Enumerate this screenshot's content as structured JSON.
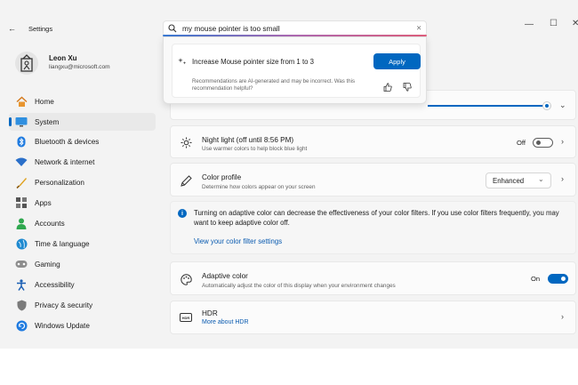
{
  "window": {
    "back_glyph": "←",
    "title": "Settings",
    "minimize_glyph": "—",
    "maximize_glyph": "☐",
    "close_glyph": "✕"
  },
  "user": {
    "name": "Leon Xu",
    "email": "liangxu@microsoft.com"
  },
  "search": {
    "query": "my mouse pointer is too small",
    "clear_glyph": "✕"
  },
  "recommendation": {
    "text": "Increase Mouse pointer size from 1 to 3",
    "apply_label": "Apply",
    "disclaimer": "Recommendations are AI-generated and may be incorrect. Was this recommendation helpful?"
  },
  "sidebar": {
    "items": [
      {
        "label": "Home",
        "icon": "home-icon"
      },
      {
        "label": "System",
        "icon": "system-icon",
        "selected": true
      },
      {
        "label": "Bluetooth & devices",
        "icon": "bluetooth-icon"
      },
      {
        "label": "Network & internet",
        "icon": "wifi-icon"
      },
      {
        "label": "Personalization",
        "icon": "brush-icon"
      },
      {
        "label": "Apps",
        "icon": "apps-icon"
      },
      {
        "label": "Accounts",
        "icon": "accounts-icon"
      },
      {
        "label": "Time & language",
        "icon": "globe-icon"
      },
      {
        "label": "Gaming",
        "icon": "gaming-icon"
      },
      {
        "label": "Accessibility",
        "icon": "accessibility-icon"
      },
      {
        "label": "Privacy & security",
        "icon": "shield-icon"
      },
      {
        "label": "Windows Update",
        "icon": "update-icon"
      }
    ]
  },
  "brightness": {
    "value_fraction": 0.98
  },
  "night_light": {
    "title": "Night light (off until 8:56 PM)",
    "subtitle": "Use warmer colors to help block blue light",
    "state_label": "Off"
  },
  "color_profile": {
    "title": "Color profile",
    "subtitle": "Determine how colors appear on your screen",
    "selected": "Enhanced"
  },
  "info": {
    "text": "Turning on adaptive color can decrease the effectiveness of your color filters. If you use color filters frequently, you may want to keep adaptive color off.",
    "link": "View your color filter settings"
  },
  "adaptive_color": {
    "title": "Adaptive color",
    "subtitle": "Automatically adjust the color of this display when your environment changes",
    "state_label": "On"
  },
  "hdr": {
    "title": "HDR",
    "link": "More about HDR"
  },
  "colors": {
    "accent": "#0067c0",
    "window_bg": "#f3f3f3",
    "card_bg": "#fbfbfb"
  }
}
